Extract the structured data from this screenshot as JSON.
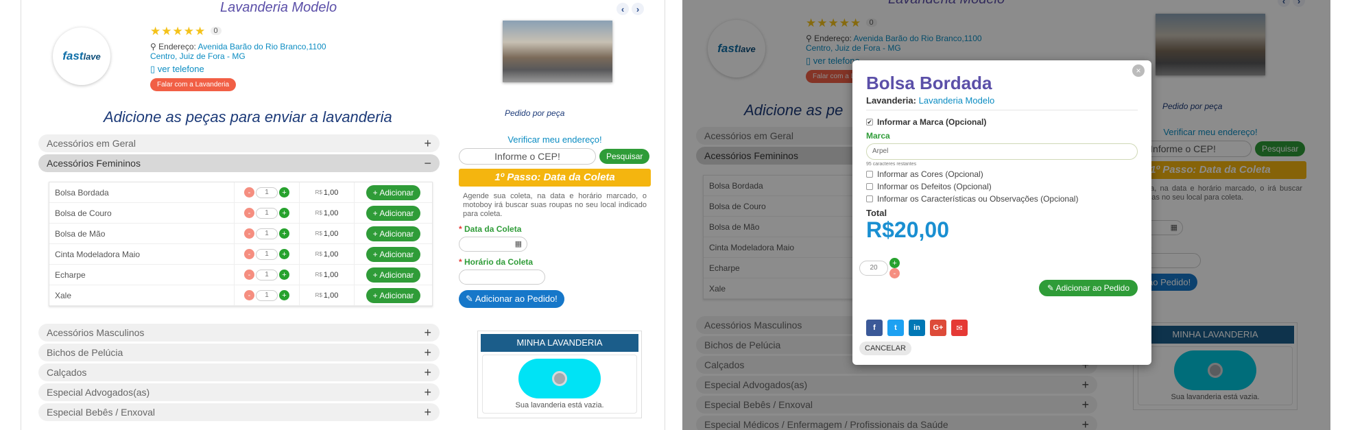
{
  "shop": {
    "name": "Lavanderia Modelo",
    "rating_count": "0",
    "stars": "★★★★★",
    "address_label": "Endereço:",
    "address_line1": "Avenida Barão do Rio Branco,1100",
    "address_line2": "Centro, Juiz de Fora - MG",
    "phone_link": "ver telefone",
    "talk_button": "Falar com a Lavanderia",
    "talk_button_short": "Falar com a L",
    "logo_fast": "fast",
    "logo_lave": "lave"
  },
  "nav": {
    "prev": "‹",
    "next": "›"
  },
  "sections": {
    "add_title": "Adicione as peças para enviar a lavanderia",
    "add_title_short": "Adicione as pe",
    "order_title": "Pedido por peça"
  },
  "accordion_top": [
    {
      "label": "Acessórios em Geral",
      "sign": "+"
    },
    {
      "label": "Acessórios Femininos",
      "sign": "−"
    }
  ],
  "items": [
    {
      "name": "Bolsa Bordada",
      "qty": "1",
      "currency": "R$",
      "price": "1,00",
      "action": "Adicionar"
    },
    {
      "name": "Bolsa de Couro",
      "qty": "1",
      "currency": "R$",
      "price": "1,00",
      "action": "Adicionar"
    },
    {
      "name": "Bolsa de Mão",
      "qty": "1",
      "currency": "R$",
      "price": "1,00",
      "action": "Adicionar"
    },
    {
      "name": "Cinta Modeladora Maio",
      "qty": "1",
      "currency": "R$",
      "price": "1,00",
      "action": "Adicionar"
    },
    {
      "name": "Echarpe",
      "qty": "1",
      "currency": "R$",
      "price": "1,00",
      "action": "Adicionar"
    },
    {
      "name": "Xale",
      "qty": "1",
      "currency": "R$",
      "price": "1,00",
      "action": "Adicionar"
    }
  ],
  "accordion_bottom_left": [
    {
      "label": "Acessórios Masculinos",
      "sign": "+"
    },
    {
      "label": "Bichos de Pelúcia",
      "sign": "+"
    },
    {
      "label": "Calçados",
      "sign": "+"
    },
    {
      "label": "Especial Advogados(as)",
      "sign": "+"
    },
    {
      "label": "Especial Bebês / Enxoval",
      "sign": "+"
    }
  ],
  "accordion_bottom_right": [
    {
      "label": "Acessórios Masculinos",
      "sign": "+"
    },
    {
      "label": "Bichos de Pelúcia",
      "sign": "+"
    },
    {
      "label": "Calçados",
      "sign": "+"
    },
    {
      "label": "Especial Advogados(as)",
      "sign": "+"
    },
    {
      "label": "Especial Bebês / Enxoval",
      "sign": "+"
    },
    {
      "label": "Especial Médicos / Enfermagem / Profissionais da Saúde",
      "sign": "+"
    }
  ],
  "order": {
    "verify": "Verificar meu endereço!",
    "cep_placeholder": "Informe o CEP!",
    "search": "Pesquisar",
    "step1": "1º Passo: Data da Coleta",
    "step_desc": "Agende sua coleta, na data e horário marcado, o motoboy irá buscar suas roupas no seu local indicado para coleta.",
    "date_label": "Data da Coleta",
    "time_label": "Horário da Coleta",
    "required": "*",
    "add_to_order": "Adicionar ao Pedido!",
    "right_step_desc": "sua coleta, na data e horário marcado, o  irá buscar suas roupas no seu local  para coleta.",
    "right_date_label": "Coleta",
    "right_time_label": "da Coleta",
    "right_add": "cionar ao Pedido!",
    "right_cep": "Informe o CEP!"
  },
  "my_laundry": {
    "title": "MINHA LAVANDERIA",
    "empty": "Sua lavanderia está vazia."
  },
  "modal": {
    "title": "Bolsa Bordada",
    "laundry_label": "Lavanderia:",
    "laundry_name": "Lavanderia Modelo",
    "check_brand": "Informar a Marca (Opcional)",
    "brand_label": "Marca",
    "brand_value": "Arpel",
    "remaining": "95 caracteres restantes",
    "check_colors": "Informar as Cores (Opcional)",
    "check_defects": "Informar os Defeitos (Opcional)",
    "check_notes": "Informar os Características ou Observações (Opcional)",
    "total_label": "Total",
    "total_value": "R$20,00",
    "qty": "20",
    "add_button": "Adicionar ao Pedido",
    "cancel": "CANCELAR",
    "close": "×",
    "share": [
      {
        "icon": "facebook-icon",
        "glyph": "f",
        "color": "#3b5998"
      },
      {
        "icon": "twitter-icon",
        "glyph": "t",
        "color": "#1da1f2"
      },
      {
        "icon": "linkedin-icon",
        "glyph": "in",
        "color": "#0077b5"
      },
      {
        "icon": "googleplus-icon",
        "glyph": "G+",
        "color": "#dd4b39"
      },
      {
        "icon": "email-icon",
        "glyph": "✉",
        "color": "#e53935"
      }
    ]
  },
  "colors": {
    "brand_purple": "#5b4fa8",
    "link_blue": "#0b8cc2",
    "green": "#2f9c38",
    "step_yellow": "#f4b50f",
    "total_blue": "#1a8fd1"
  }
}
